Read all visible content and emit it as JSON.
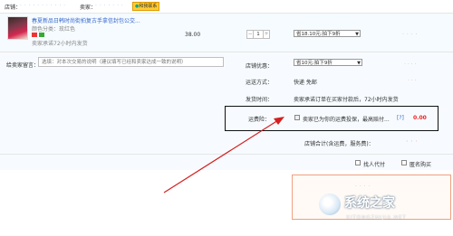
{
  "header": {
    "store_label": "店铺：",
    "seller_label": "卖家：",
    "contact_label": "和我联系"
  },
  "product": {
    "title": "春夏新品日韩时尚街拍复古手拿信封包公交...",
    "color_prefix": "颜色分类：",
    "color_value": "玫红色",
    "promise": "卖家承诺72小时内发货",
    "price": "38.00",
    "quantity": "1",
    "discount_text": "省18.10元:拍下9折"
  },
  "message": {
    "label": "给卖家留言：",
    "placeholder": "选填：对本次交易的说明（建议填写已经和卖家达成一致的说明）"
  },
  "shop_discount": {
    "label": "店铺优惠：",
    "value": "省10元:拍下9折"
  },
  "shipping": {
    "method_label": "运送方式：",
    "method_value": "快递  免邮",
    "time_label": "发货时间：",
    "time_value": "卖家承诺订单在买家付款后，72小时内发货"
  },
  "insurance": {
    "label": "运费险：",
    "text": "卖家已为你的运费投保，最高赔付...",
    "help": "[?]",
    "amount": "0.00"
  },
  "total": {
    "label": "店铺合计(含运费，服务费)："
  },
  "options": {
    "proxy_pay": "找人代付",
    "anonymous": "匿名购买"
  },
  "watermark": {
    "brand": "系统之家",
    "url": "XITONGZHIJIA.NET"
  },
  "colors": {
    "accent_red": "#e22222",
    "annotation_arrow": "#d42020",
    "link_blue": "#3366cc"
  }
}
